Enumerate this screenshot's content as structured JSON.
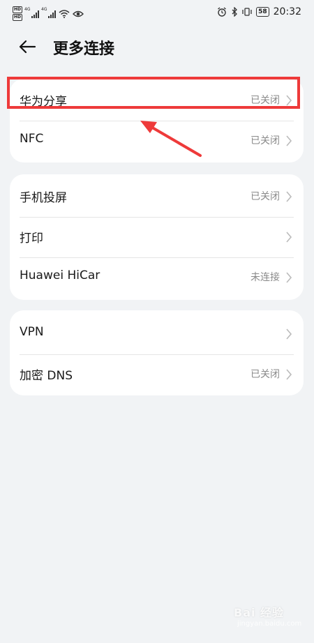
{
  "status_bar": {
    "hd1": "HD",
    "hd2": "HD",
    "sig1_label": "4G",
    "sig2_label": "4G",
    "battery": "58",
    "time": "20:32"
  },
  "header": {
    "title": "更多连接"
  },
  "group1": [
    {
      "label": "华为分享",
      "value": "已关闭"
    },
    {
      "label": "NFC",
      "value": "已关闭"
    }
  ],
  "group2": [
    {
      "label": "手机投屏",
      "value": "已关闭"
    },
    {
      "label": "打印",
      "value": ""
    },
    {
      "label": "Huawei HiCar",
      "value": "未连接"
    }
  ],
  "group3": [
    {
      "label": "VPN",
      "value": ""
    },
    {
      "label": "加密 DNS",
      "value": "已关闭"
    }
  ],
  "annotation": {
    "color": "#ee3a3a"
  },
  "watermark": {
    "text": "Bai 经验",
    "sub": "jingyan.baidu.com"
  }
}
